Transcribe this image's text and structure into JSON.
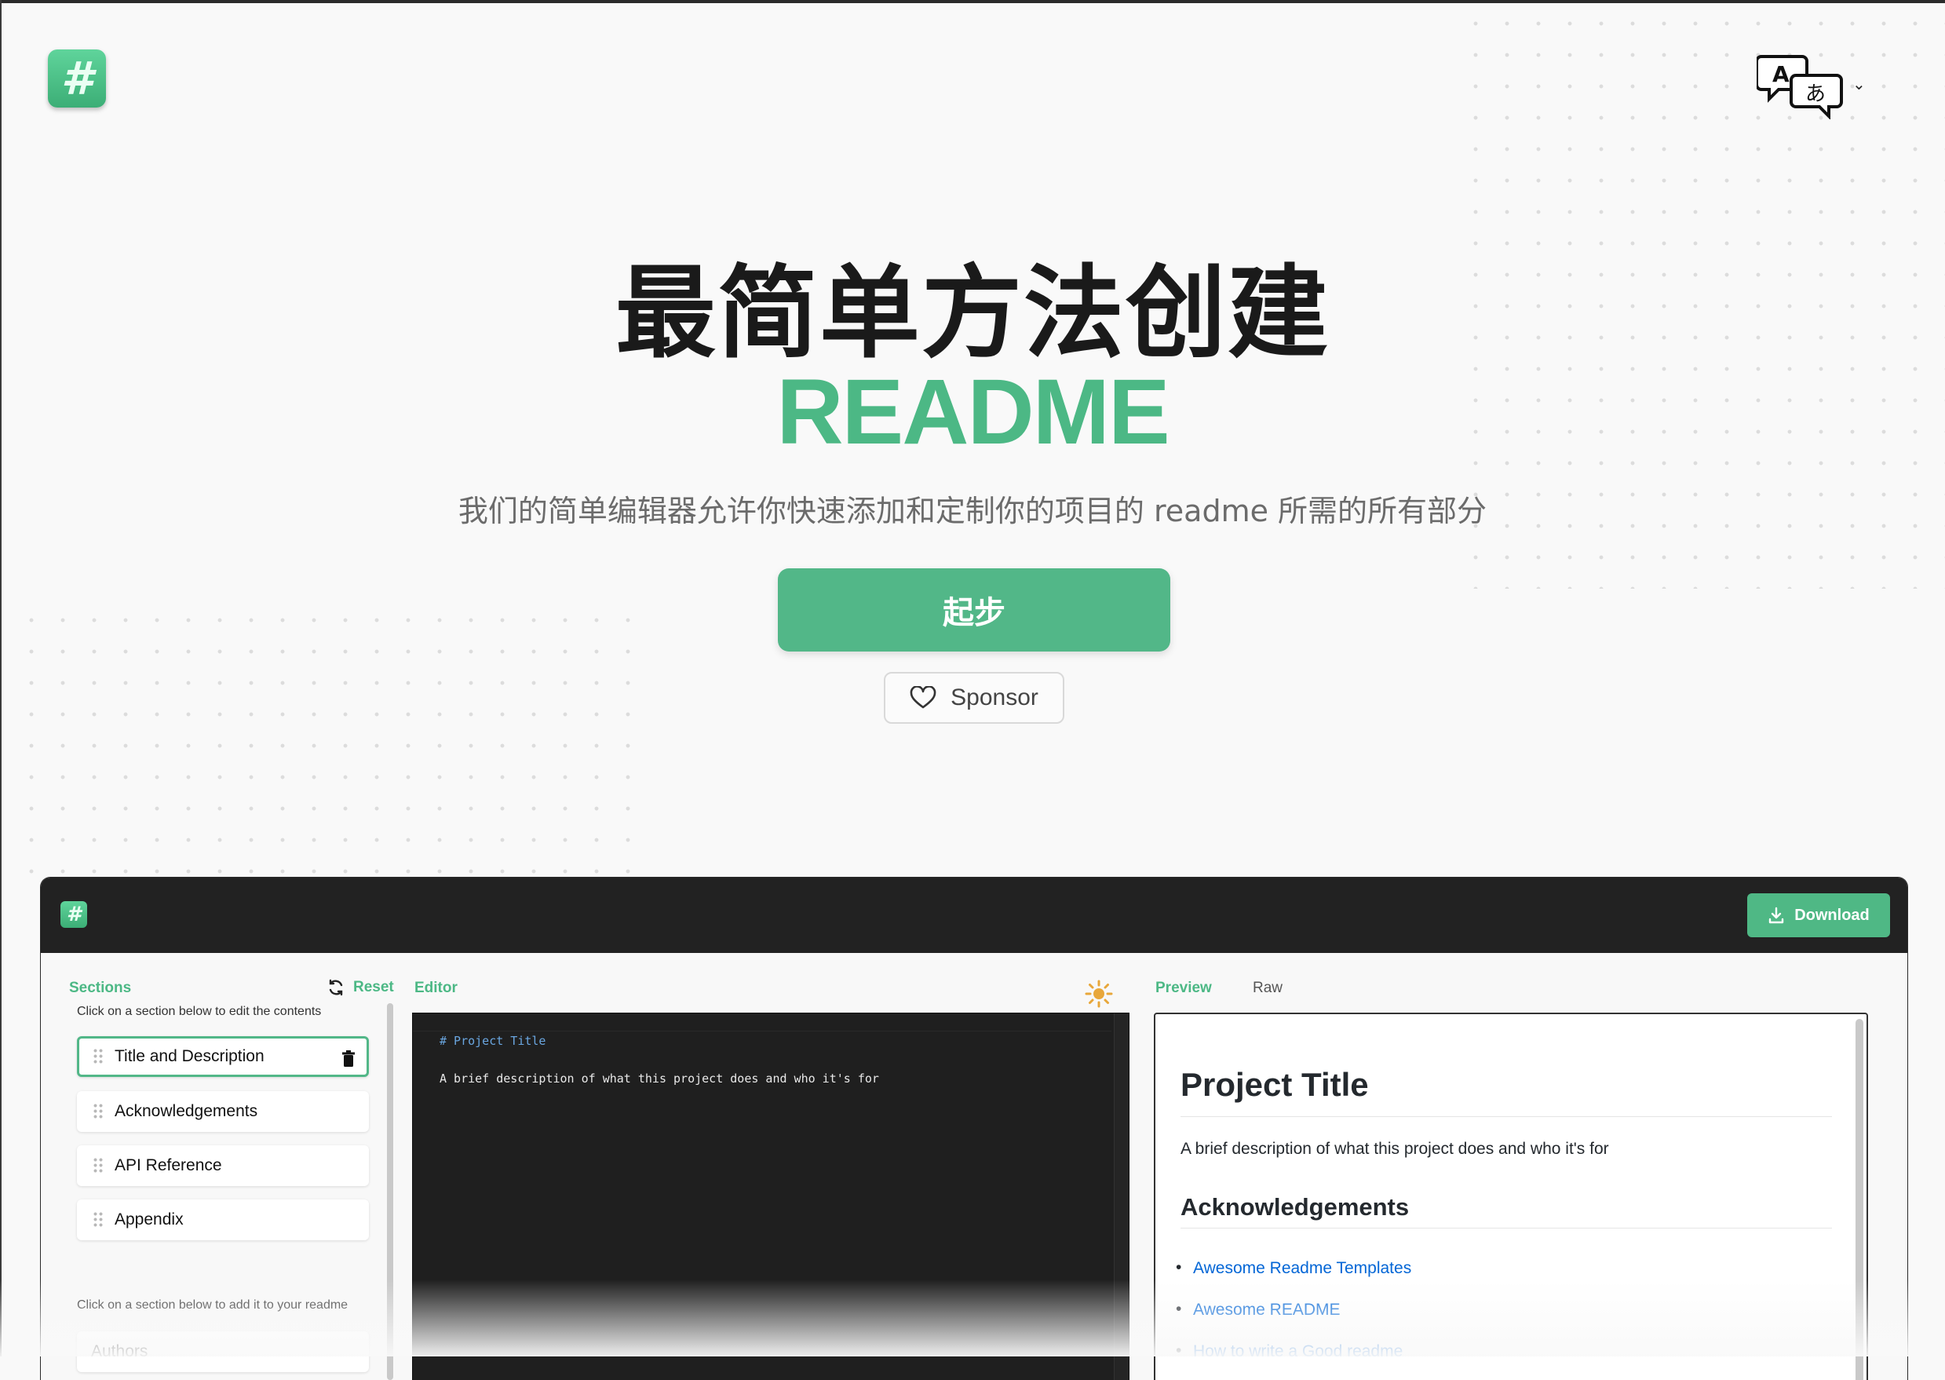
{
  "brand": {
    "logo_glyph": "#",
    "accent": "#52b788",
    "dark": "#222222"
  },
  "language_switcher": {
    "icon": "translate-icon"
  },
  "hero": {
    "title_line1": "最简单方法创建",
    "title_line2": "README",
    "subtitle": "我们的简单编辑器允许你快速添加和定制你的项目的 readme 所需的所有部分",
    "start_button": "起步",
    "sponsor_button": "Sponsor"
  },
  "app": {
    "download_button": "Download",
    "sections": {
      "label": "Sections",
      "reset": "Reset",
      "edit_hint": "Click on a section below to edit the contents",
      "add_hint": "Click on a section below to add it to your readme",
      "items": [
        "Title and Description",
        "Acknowledgements",
        "API Reference",
        "Appendix"
      ],
      "available": [
        "Authors"
      ]
    },
    "editor": {
      "label": "Editor",
      "line1": "# Project Title",
      "line2": "A brief description of what this project does and who it's for"
    },
    "preview": {
      "tab_preview": "Preview",
      "tab_raw": "Raw",
      "h1": "Project Title",
      "paragraph": "A brief description of what this project does and who it's for",
      "h2": "Acknowledgements",
      "links": [
        "Awesome Readme Templates",
        "Awesome README",
        "How to write a Good readme"
      ]
    }
  }
}
